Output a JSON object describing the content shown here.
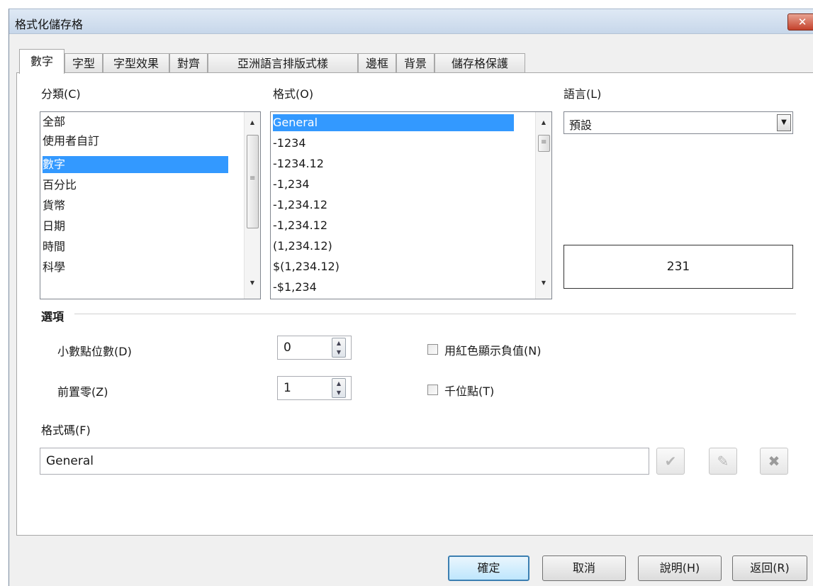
{
  "dialog": {
    "title": "格式化儲存格",
    "close_glyph": "✕"
  },
  "tabs": [
    {
      "label": "數字"
    },
    {
      "label": "字型"
    },
    {
      "label": "字型效果"
    },
    {
      "label": "對齊"
    },
    {
      "label": "亞洲語言排版式樣"
    },
    {
      "label": "邊框"
    },
    {
      "label": "背景"
    },
    {
      "label": "儲存格保護"
    }
  ],
  "category": {
    "label": "分類(C)",
    "selected": "數字",
    "items": [
      "全部",
      "使用者自訂",
      "數字",
      "百分比",
      "貨幣",
      "日期",
      "時間",
      "科學"
    ]
  },
  "format": {
    "label": "格式(O)",
    "selected": "General",
    "items": [
      "General",
      "-1234",
      "-1234.12",
      "-1,234",
      "-1,234.12",
      "-1,234.12",
      " (1,234.12)",
      " $(1,234.12)",
      "-$1,234"
    ]
  },
  "language": {
    "label": "語言(L)",
    "value": "預設"
  },
  "preview": {
    "value": "231"
  },
  "options": {
    "label": "選項",
    "decimal_places": {
      "label": "小數點位數(D)",
      "value": "0"
    },
    "leading_zeros": {
      "label": "前置零(Z)",
      "value": "1"
    },
    "negative_red": {
      "label": "用紅色顯示負值(N)",
      "checked": false
    },
    "thousands_sep": {
      "label": "千位點(T)",
      "checked": false
    }
  },
  "format_code": {
    "label": "格式碼(F)",
    "value": "General"
  },
  "buttons": {
    "ok": "確定",
    "cancel": "取消",
    "help": "說明(H)",
    "reset": "返回(R)"
  },
  "icons": {
    "accept": "check-icon",
    "comment": "edit-comment-icon",
    "delete": "delete-icon"
  }
}
